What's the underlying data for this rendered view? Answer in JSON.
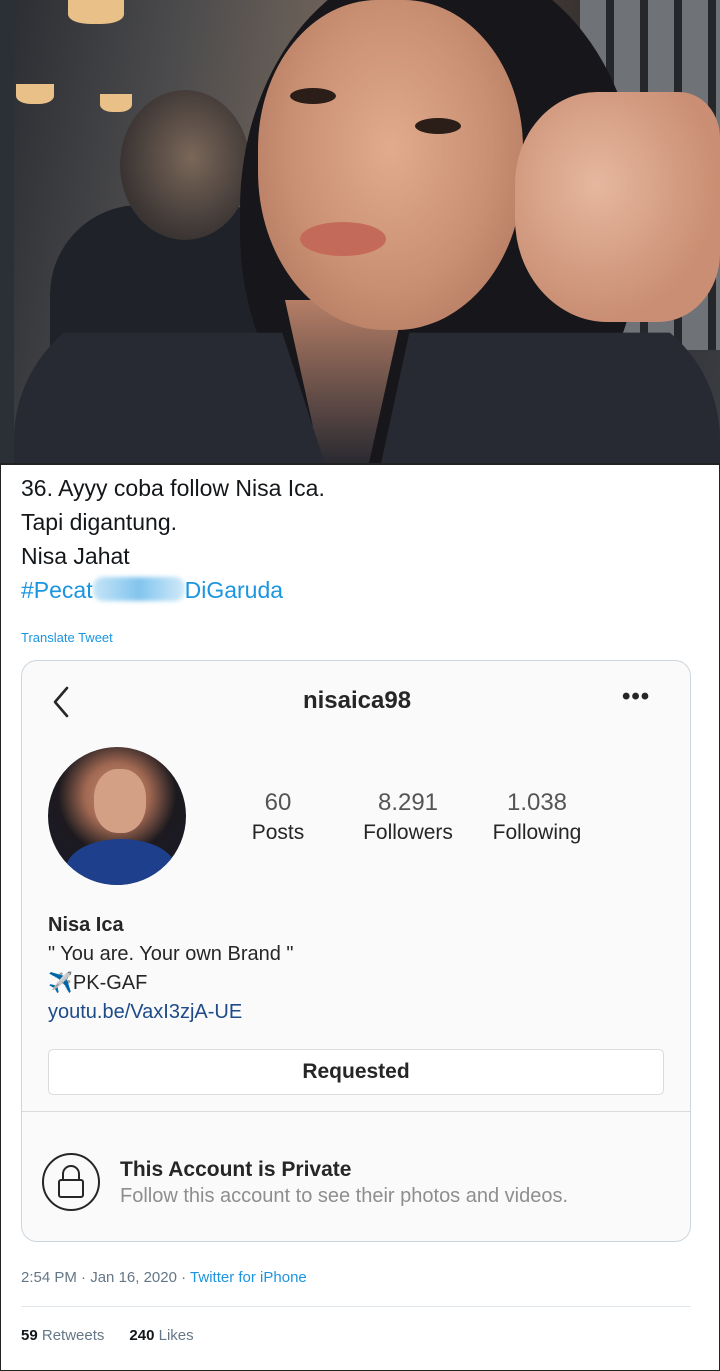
{
  "tweet": {
    "lines": [
      "36. Ayyy coba follow Nisa Ica.",
      "Tapi digantung.",
      "Nisa Jahat"
    ],
    "hashtag_start": "#Pecat",
    "hashtag_end": "DiGaruda",
    "translate_label": "Translate Tweet",
    "time": "2:54 PM",
    "date": "Jan 16, 2020",
    "source": "Twitter for iPhone",
    "retweets_count": "59",
    "retweets_label": "Retweets",
    "likes_count": "240",
    "likes_label": "Likes"
  },
  "instagram": {
    "username": "nisaica98",
    "more_icon": "more-horizontal-icon",
    "back_icon": "chevron-left-icon",
    "stats": [
      {
        "value": "60",
        "label": "Posts"
      },
      {
        "value": "8.291",
        "label": "Followers"
      },
      {
        "value": "1.038",
        "label": "Following"
      }
    ],
    "bio": {
      "name": "Nisa Ica",
      "quote": "\" You are. Your own Brand \"",
      "plane_glyph": "✈️",
      "reg": "PK-GAF",
      "link": "youtu.be/VaxI3zjA-UE"
    },
    "requested_label": "Requested",
    "private_title": "This Account is Private",
    "private_subtitle": "Follow this account to see their photos and videos."
  },
  "colors": {
    "twitter_blue": "#1b95e0",
    "ig_link": "#1e4a8a",
    "muted": "#8e8e8e"
  }
}
